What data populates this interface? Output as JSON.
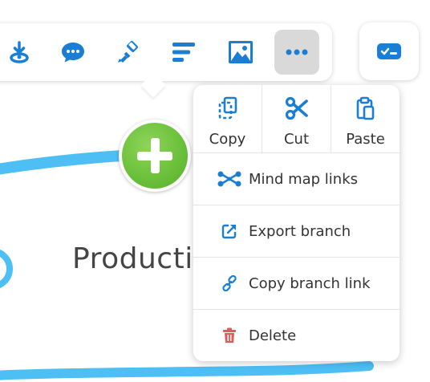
{
  "canvas": {
    "node_text": "Productiv",
    "branch_color": "#4dbff5",
    "add_button_color": "#6cc13c"
  },
  "toolbar": {
    "buttons": [
      {
        "icon": "download-location-icon"
      },
      {
        "icon": "comment-icon"
      },
      {
        "icon": "paint-brush-icon"
      },
      {
        "icon": "align-left-icon"
      },
      {
        "icon": "image-icon"
      },
      {
        "icon": "more-horizontal-icon",
        "active": true
      }
    ],
    "accent_color": "#1a7fd4",
    "side_button_icon": "card-checklist-icon"
  },
  "menu": {
    "clipboard": [
      {
        "label": "Copy",
        "icon": "copy-icon"
      },
      {
        "label": "Cut",
        "icon": "scissors-icon"
      },
      {
        "label": "Paste",
        "icon": "paste-icon"
      }
    ],
    "items": [
      {
        "label": "Mind map links",
        "icon": "mind-map-links-icon"
      },
      {
        "label": "Export branch",
        "icon": "export-icon"
      },
      {
        "label": "Copy branch link",
        "icon": "link-icon"
      },
      {
        "label": "Delete",
        "icon": "trash-icon",
        "color": "#e05a5a"
      }
    ]
  }
}
